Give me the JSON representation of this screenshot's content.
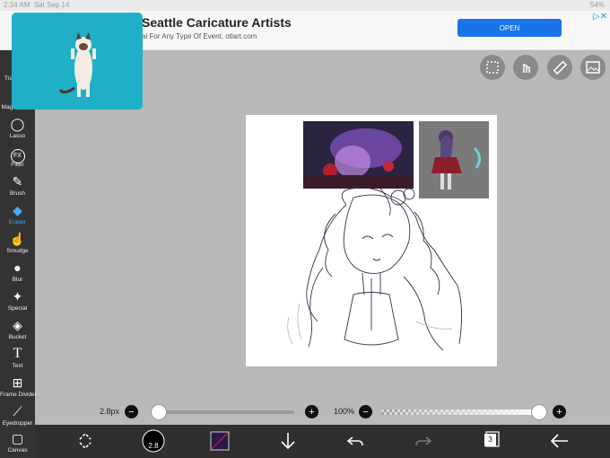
{
  "status": {
    "time": "2:34 AM",
    "date": "Sat Sep 14",
    "battery": "54%"
  },
  "ad": {
    "title": "Seattle Caricature Artists",
    "subtitle": "al For Any Type Of Event. otlart.com",
    "open_label": "OPEN",
    "close_icon": "ad-choices-icon"
  },
  "left_toolbar": {
    "items": [
      {
        "label": "Transform",
        "icon": "move-icon"
      },
      {
        "label": "Magic Wand",
        "icon": "wand-icon"
      },
      {
        "label": "Lasso",
        "icon": "lasso-icon"
      },
      {
        "label": "Filter",
        "icon": "fx-icon",
        "glyph": "FX"
      },
      {
        "label": "Brush",
        "icon": "brush-icon"
      },
      {
        "label": "Eraser",
        "icon": "eraser-icon",
        "active": true
      },
      {
        "label": "Smudge",
        "icon": "smudge-icon"
      },
      {
        "label": "Blur",
        "icon": "blur-icon"
      },
      {
        "label": "Special",
        "icon": "special-icon"
      },
      {
        "label": "Bucket",
        "icon": "bucket-icon"
      },
      {
        "label": "Text",
        "icon": "text-icon",
        "glyph": "T"
      },
      {
        "label": "Frame Divider",
        "icon": "frame-divider-icon"
      },
      {
        "label": "Eyedropper",
        "icon": "eyedropper-icon"
      },
      {
        "label": "Canvas",
        "icon": "canvas-icon"
      }
    ]
  },
  "top_right_buttons": [
    "selection-icon",
    "touch-icon",
    "ruler-icon",
    "image-icon"
  ],
  "brush_size": {
    "label": "2.8px",
    "fraction": 0.0
  },
  "opacity": {
    "label": "100%",
    "fraction": 1.0
  },
  "bottom_toolbar": {
    "brush_preview_value": "2.8",
    "layers_count": "3",
    "items": [
      "transform-tool-icon",
      "brush-preview",
      "color-swatch",
      "download-icon",
      "undo-icon",
      "redo-icon",
      "layers-icon",
      "back-arrow-icon"
    ]
  },
  "colors": {
    "accent": "#4aa8ff",
    "toolbar_bg": "#333333",
    "workspace_bg": "#b9b9b9",
    "ad_button": "#1a73e8"
  }
}
